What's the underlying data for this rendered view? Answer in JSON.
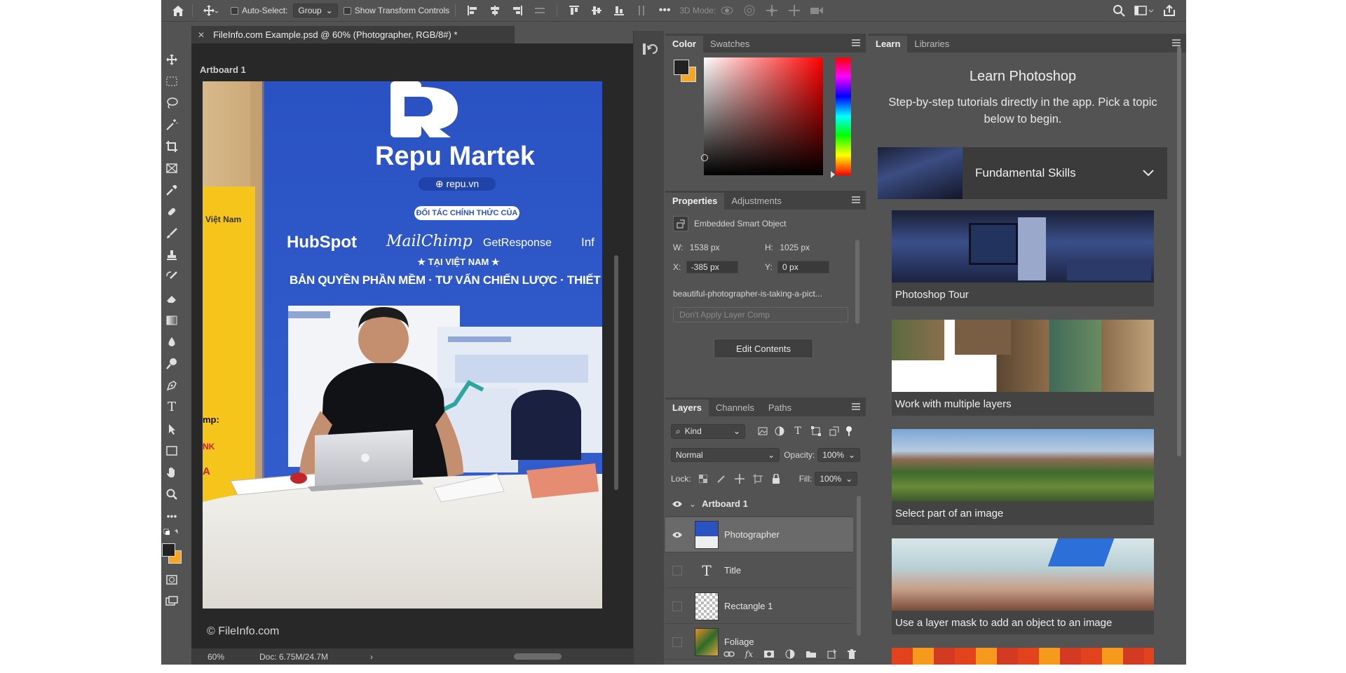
{
  "colors": {
    "panel_bg": "#535353",
    "canvas_bg": "#282828",
    "foreground": "#222222",
    "background": "#f5a623",
    "selected_layer": "#6a6a6a"
  },
  "options_bar": {
    "home_icon": "home-icon",
    "auto_select_label": "Auto-Select:",
    "auto_select_value": "Group",
    "transform_label": "Show Transform Controls",
    "mode_3d_label": "3D Mode:"
  },
  "document": {
    "tab_title": "FileInfo.com Example.psd @ 60% (Photographer, RGB/8#) *",
    "artboard_label": "Artboard 1",
    "watermark": "© FileInfo.com",
    "photo": {
      "brand": "Repu Martek",
      "site": "⊕ repu.vn",
      "partner_badge": "ĐỐI TÁC CHÍNH THỨC CỦA",
      "partners": [
        "HubSpot",
        "MailChimp",
        "GetResponse",
        "Inf"
      ],
      "region": "★ TẠI VIỆT NAM ★",
      "services": "BẢN QUYỀN PHẦN MỀM · TƯ VẤN CHIẾN LƯỢC · THIẾT LẬP LẦN ĐẦU · HỖ T",
      "left_sign": "Việt Nam",
      "left_sign_2": "mp:",
      "left_sign_3": "NK",
      "left_sign_4": "A"
    }
  },
  "status": {
    "zoom": "60%",
    "doc": "Doc: 6.75M/24.7M"
  },
  "color_panel": {
    "tabs": [
      "Color",
      "Swatches"
    ]
  },
  "properties_panel": {
    "tabs": [
      "Properties",
      "Adjustments"
    ],
    "object_type": "Embedded Smart Object",
    "w_label": "W:",
    "w_value": "1538 px",
    "h_label": "H:",
    "h_value": "1025 px",
    "x_label": "X:",
    "x_value": "-385 px",
    "y_label": "Y:",
    "y_value": "0 px",
    "filename": "beautiful-photographer-is-taking-a-pict...",
    "layer_comp": "Don't Apply Layer Comp",
    "edit_button": "Edit Contents"
  },
  "layers_panel": {
    "tabs": [
      "Layers",
      "Channels",
      "Paths"
    ],
    "kind_label": "Kind",
    "blend_mode": "Normal",
    "opacity_label": "Opacity:",
    "opacity_value": "100%",
    "lock_label": "Lock:",
    "fill_label": "Fill:",
    "fill_value": "100%",
    "layers": [
      {
        "name": "Artboard 1",
        "visible": true,
        "type": "artboard"
      },
      {
        "name": "Photographer",
        "visible": true,
        "selected": true,
        "type": "smart-object"
      },
      {
        "name": "Title",
        "visible": false,
        "type": "text"
      },
      {
        "name": "Rectangle 1",
        "visible": false,
        "type": "shape"
      },
      {
        "name": "Foliage",
        "visible": false,
        "type": "image"
      }
    ]
  },
  "learn_panel": {
    "tabs": [
      "Learn",
      "Libraries"
    ],
    "title": "Learn Photoshop",
    "subtitle": "Step-by-step tutorials directly in the app. Pick a topic below to begin.",
    "category": "Fundamental Skills",
    "tutorials": [
      {
        "label": "Photoshop Tour"
      },
      {
        "label": "Work with multiple layers"
      },
      {
        "label": "Select part of an image"
      },
      {
        "label": "Use a layer mask to add an object to an image"
      }
    ]
  }
}
